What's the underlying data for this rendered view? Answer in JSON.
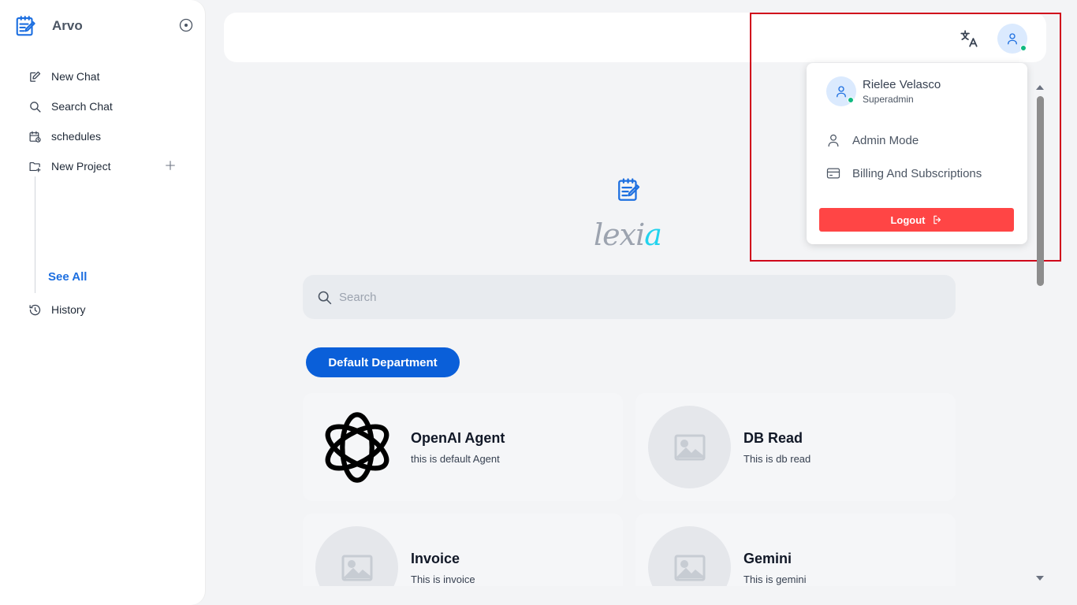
{
  "sidebar": {
    "brand": "Arvo",
    "items": [
      {
        "label": "New Chat",
        "icon": "edit-icon"
      },
      {
        "label": "Search Chat",
        "icon": "search-icon"
      },
      {
        "label": "schedules",
        "icon": "calendar-clock-icon"
      },
      {
        "label": "New Project",
        "icon": "folder-plus-icon"
      }
    ],
    "see_all": "See All",
    "history": "History"
  },
  "user_menu": {
    "name": "Rielee Velasco",
    "role": "Superadmin",
    "admin_mode": "Admin Mode",
    "billing": "Billing And Subscriptions",
    "logout": "Logout"
  },
  "main": {
    "wordmark_a": "lexi",
    "wordmark_b": "a",
    "search_placeholder": "Search",
    "department": "Default Department",
    "agents": [
      {
        "title": "OpenAI Agent",
        "desc": "this is default Agent"
      },
      {
        "title": "DB Read",
        "desc": "This is db read"
      },
      {
        "title": "Invoice",
        "desc": "This is invoice"
      },
      {
        "title": "Gemini",
        "desc": "This is gemini"
      }
    ]
  },
  "colors": {
    "accent": "#0a5fd9",
    "logout": "#ff4545",
    "online": "#10b981",
    "highlight": "#d0021b"
  }
}
